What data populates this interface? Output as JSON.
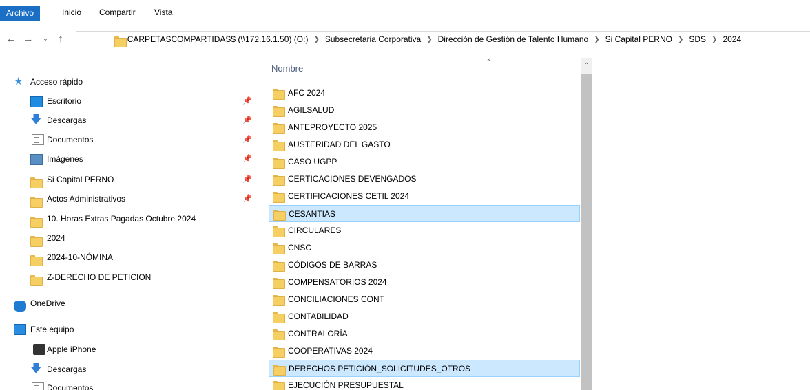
{
  "ribbon": {
    "tabs": [
      "Archivo",
      "Inicio",
      "Compartir",
      "Vista"
    ]
  },
  "navigation": {
    "back_icon": "arrow-left",
    "forward_icon": "arrow-right",
    "recent_icon": "chevron-down",
    "up_icon": "arrow-up"
  },
  "address": {
    "lead": "«",
    "crumbs": [
      "CARPETASCOMPARTIDAS$ (\\\\172.16.1.50) (O:)",
      "Subsecretaria Corporativa",
      "Dirección de Gestión de Talento Humano",
      "Si Capital PERNO",
      "SDS",
      "2024"
    ]
  },
  "nav_pane": {
    "quick_access": "Acceso rápido",
    "quick_items": [
      {
        "label": "Escritorio",
        "icon": "desktop-icon",
        "pinned": true
      },
      {
        "label": "Descargas",
        "icon": "download-icon",
        "pinned": true
      },
      {
        "label": "Documentos",
        "icon": "documents-icon",
        "pinned": true
      },
      {
        "label": "Imágenes",
        "icon": "images-icon",
        "pinned": true
      },
      {
        "label": "Si Capital PERNO",
        "icon": "folder-icon",
        "pinned": true
      },
      {
        "label": "Actos Administrativos",
        "icon": "folder-icon",
        "pinned": true
      },
      {
        "label": "10. Horas Extras Pagadas Octubre 2024",
        "icon": "folder-icon",
        "pinned": false
      },
      {
        "label": "2024",
        "icon": "folder-icon",
        "pinned": false
      },
      {
        "label": "2024-10-NÓMINA",
        "icon": "folder-icon",
        "pinned": false
      },
      {
        "label": "Z-DERECHO DE PETICION",
        "icon": "folder-icon",
        "pinned": false
      }
    ],
    "onedrive": "OneDrive",
    "this_pc": "Este equipo",
    "pc_items": [
      {
        "label": "Apple iPhone",
        "icon": "phone-icon"
      },
      {
        "label": "Descargas",
        "icon": "download-icon"
      },
      {
        "label": "Documentos",
        "icon": "documents-icon"
      }
    ]
  },
  "file_list": {
    "column_header": "Nombre",
    "items": [
      {
        "name": "AFC 2024",
        "selected": false
      },
      {
        "name": "AGILSALUD",
        "selected": false
      },
      {
        "name": "ANTEPROYECTO 2025",
        "selected": false
      },
      {
        "name": "AUSTERIDAD DEL GASTO",
        "selected": false
      },
      {
        "name": "CASO UGPP",
        "selected": false
      },
      {
        "name": "CERTICACIONES DEVENGADOS",
        "selected": false
      },
      {
        "name": "CERTIFICACIONES CETIL 2024",
        "selected": false
      },
      {
        "name": "CESANTIAS",
        "selected": true
      },
      {
        "name": "CIRCULARES",
        "selected": false
      },
      {
        "name": "CNSC",
        "selected": false
      },
      {
        "name": "CÓDIGOS DE BARRAS",
        "selected": false
      },
      {
        "name": "COMPENSATORIOS 2024",
        "selected": false
      },
      {
        "name": "CONCILIACIONES CONT",
        "selected": false
      },
      {
        "name": "CONTABILIDAD",
        "selected": false
      },
      {
        "name": "CONTRALORÍA",
        "selected": false
      },
      {
        "name": "COOPERATIVAS 2024",
        "selected": false
      },
      {
        "name": "DERECHOS PETICIÓN_SOLICITUDES_OTROS",
        "selected": true
      },
      {
        "name": "EJECUCIÓN PRESUPUESTAL",
        "selected": false
      }
    ]
  },
  "colors": {
    "ribbon_file_tab": "#1a6fc4",
    "selection_bg": "#cce8ff",
    "selection_border": "#99d1ff",
    "folder_yellow": "#f6cf63"
  }
}
